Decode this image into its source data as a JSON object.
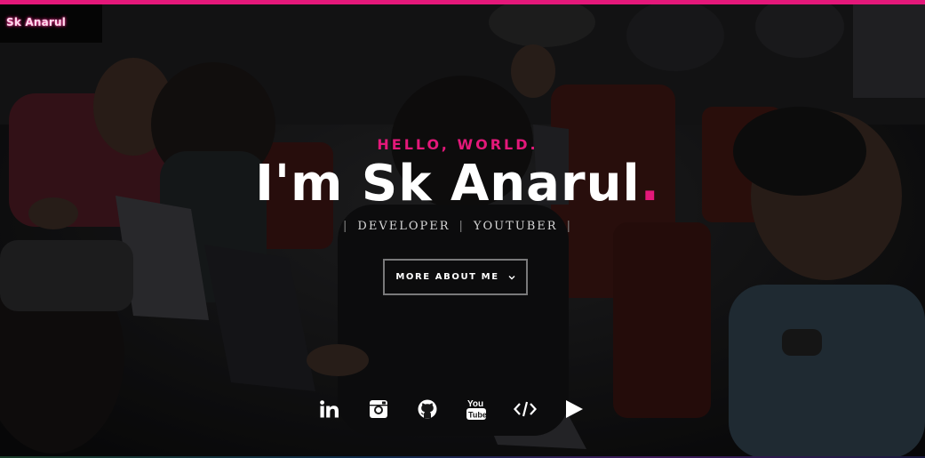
{
  "brand": {
    "logo_text": "Sk Anarul",
    "accent": "#e4187a"
  },
  "hero": {
    "kicker": "HELLO, WORLD.",
    "headline_name": "I'm Sk Anarul",
    "headline_dot": ".",
    "roles": [
      "DEVELOPER",
      "YOUTUBER"
    ],
    "role_separator": "|",
    "cta_label": "MORE ABOUT ME",
    "cta_icon": "chevron-down-icon"
  },
  "social": [
    {
      "name": "linkedin-icon"
    },
    {
      "name": "instagram-icon"
    },
    {
      "name": "github-icon"
    },
    {
      "name": "youtube-icon"
    },
    {
      "name": "code-icon"
    },
    {
      "name": "play-icon"
    }
  ]
}
